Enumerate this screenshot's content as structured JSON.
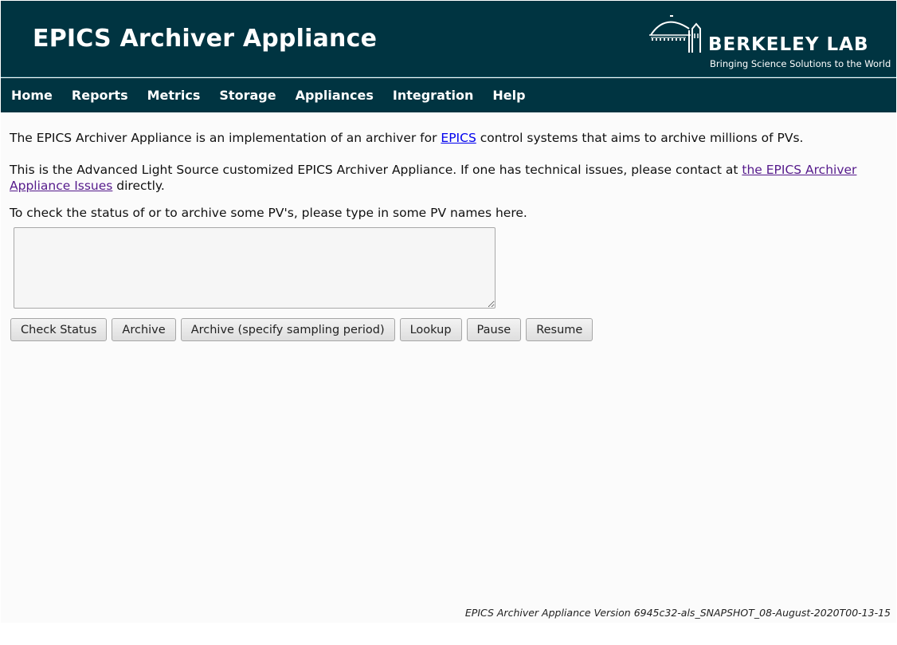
{
  "header": {
    "app_title": "EPICS Archiver Appliance",
    "logo_text": "BERKELEY LAB",
    "logo_tagline": "Bringing Science Solutions to the World"
  },
  "nav": {
    "items": [
      {
        "label": "Home"
      },
      {
        "label": "Reports"
      },
      {
        "label": "Metrics"
      },
      {
        "label": "Storage"
      },
      {
        "label": "Appliances"
      },
      {
        "label": "Integration"
      },
      {
        "label": "Help"
      }
    ]
  },
  "main": {
    "intro_before": "The EPICS Archiver Appliance is an implementation of an archiver for ",
    "intro_link": "EPICS",
    "intro_after": " control systems that aims to archive millions of PVs.",
    "contact_before": "This is the Advanced Light Source customized EPICS Archiver Appliance. If one has technical issues, please contact at ",
    "contact_link": "the EPICS Archiver Appliance Issues",
    "contact_after": " directly.",
    "prompt": "To check the status of or to archive some PV's, please type in some PV names here.",
    "pv_input_value": "",
    "buttons": {
      "check_status": "Check Status",
      "archive": "Archive",
      "archive_period": "Archive (specify sampling period)",
      "lookup": "Lookup",
      "pause": "Pause",
      "resume": "Resume"
    }
  },
  "footer": {
    "version": "EPICS Archiver Appliance Version 6945c32-als_SNAPSHOT_08-August-2020T00-13-15"
  },
  "colors": {
    "header_bg": "#003441",
    "link": "#0000ee",
    "link_visited": "#551a8b"
  },
  "icons": {
    "logo": "berkeley-lab-logo-icon"
  }
}
